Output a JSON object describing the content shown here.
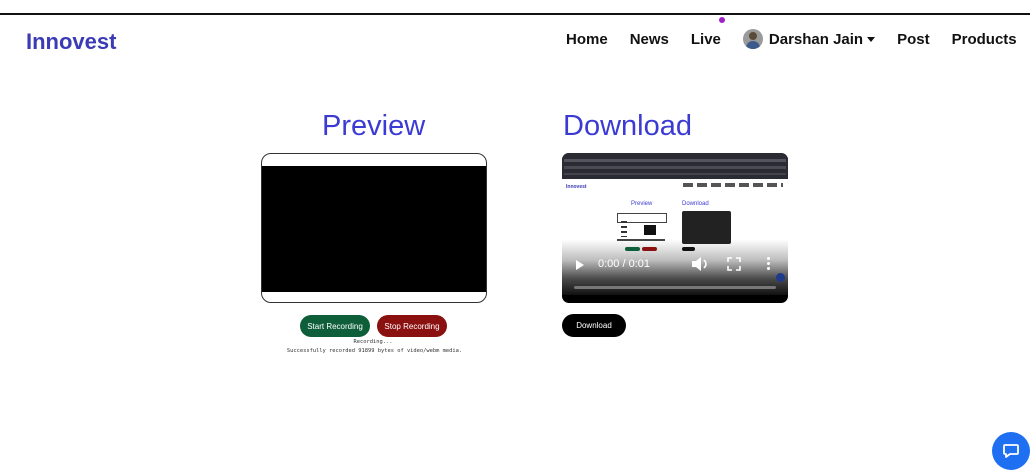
{
  "brand": "Innovest",
  "nav": {
    "items": [
      "Home",
      "News",
      "Live"
    ],
    "user_name": "Darshan Jain",
    "post": "Post",
    "products": "Products"
  },
  "preview": {
    "heading": "Preview"
  },
  "download": {
    "heading": "Download",
    "button": "Download"
  },
  "recording": {
    "start_label": "Start Recording",
    "stop_label": "Stop Recording",
    "status_line1": "Recording...",
    "status_line2": "Successfully recorded 91899 bytes of video/webm media."
  },
  "player": {
    "time": "0:00 / 0:01",
    "mini": {
      "brand": "Innovest",
      "preview": "Preview",
      "download": "Download"
    }
  },
  "colors": {
    "brand": "#3b3bb5",
    "heading": "#3b3bd4",
    "start_button": "#0e5e3a",
    "stop_button": "#8b1010",
    "download_button": "#000000",
    "live_dot": "#a020c8",
    "chat_button": "#1f6ff2"
  },
  "icons": [
    "play-icon",
    "volume-icon",
    "fullscreen-icon",
    "more-options-icon",
    "chat-icon",
    "caret-down-icon",
    "avatar"
  ]
}
